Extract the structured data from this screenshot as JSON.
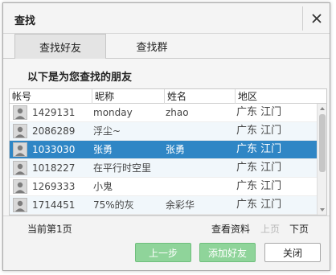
{
  "dialog": {
    "title": "查找",
    "close_icon": "close-icon"
  },
  "tabs": [
    {
      "label": "查找好友",
      "active": true
    },
    {
      "label": "查找群",
      "active": false
    }
  ],
  "subheading": "以下是为您查找的朋友",
  "table": {
    "headers": [
      "帐号",
      "昵称",
      "姓名",
      "地区"
    ],
    "rows": [
      {
        "id": "1429131",
        "nickname": "monday",
        "name": "zhao",
        "area": "广东 江门",
        "selected": false
      },
      {
        "id": "2086289",
        "nickname": "浮尘~",
        "name": "",
        "area": "广东 江门",
        "selected": false
      },
      {
        "id": "1033030",
        "nickname": "张勇",
        "name": "张勇",
        "area": "广东 江门",
        "selected": true
      },
      {
        "id": "1018227",
        "nickname": "在平行时空里",
        "name": "",
        "area": "广东 江门",
        "selected": false
      },
      {
        "id": "1269333",
        "nickname": "小鬼",
        "name": "",
        "area": "广东 江门",
        "selected": false
      },
      {
        "id": "1714451",
        "nickname": "75%的灰",
        "name": "余彩华",
        "area": "广东 江门",
        "selected": false
      }
    ]
  },
  "pager": {
    "current": "当前第1页",
    "view_profile": "查看资料",
    "prev": "上页",
    "next": "下页"
  },
  "footer": {
    "prev_step": "上一步",
    "add_friend": "添加好友",
    "close": "关闭"
  },
  "colors": {
    "selected_row": "#2f86c5",
    "green_button": "#8fd49a"
  }
}
